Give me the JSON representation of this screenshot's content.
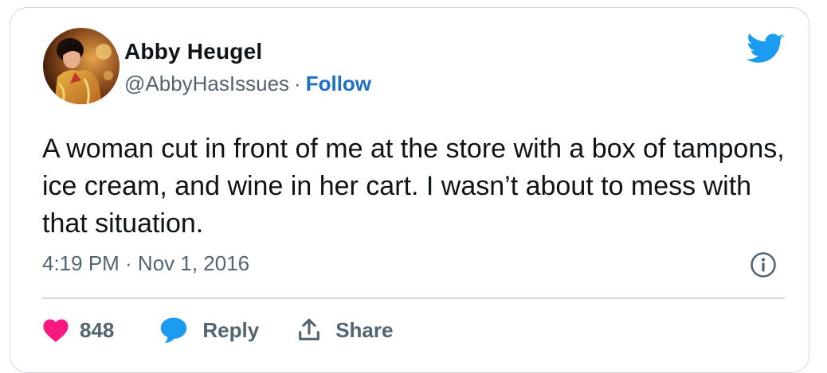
{
  "tweet": {
    "author_name": "Abby Heugel",
    "author_handle": "@AbbyHasIssues",
    "separator": "·",
    "follow_label": "Follow",
    "text": "A woman cut in front of me at the store with a box of tampons, ice cream, and wine in her cart. I wasn’t about to mess with that situation.",
    "timestamp": "4:19 PM · Nov 1, 2016",
    "likes_count": "848",
    "reply_label": "Reply",
    "share_label": "Share"
  },
  "icons": {
    "brand": "twitter-bird-icon",
    "info": "info-icon",
    "like": "heart-icon",
    "reply": "speech-bubble-icon",
    "share": "share-upload-icon"
  },
  "colors": {
    "twitter_blue": "#1d9bf0",
    "follow_link": "#1d70c4",
    "like_pink": "#f91880",
    "muted_text": "#536471",
    "border": "#cfd9de"
  }
}
